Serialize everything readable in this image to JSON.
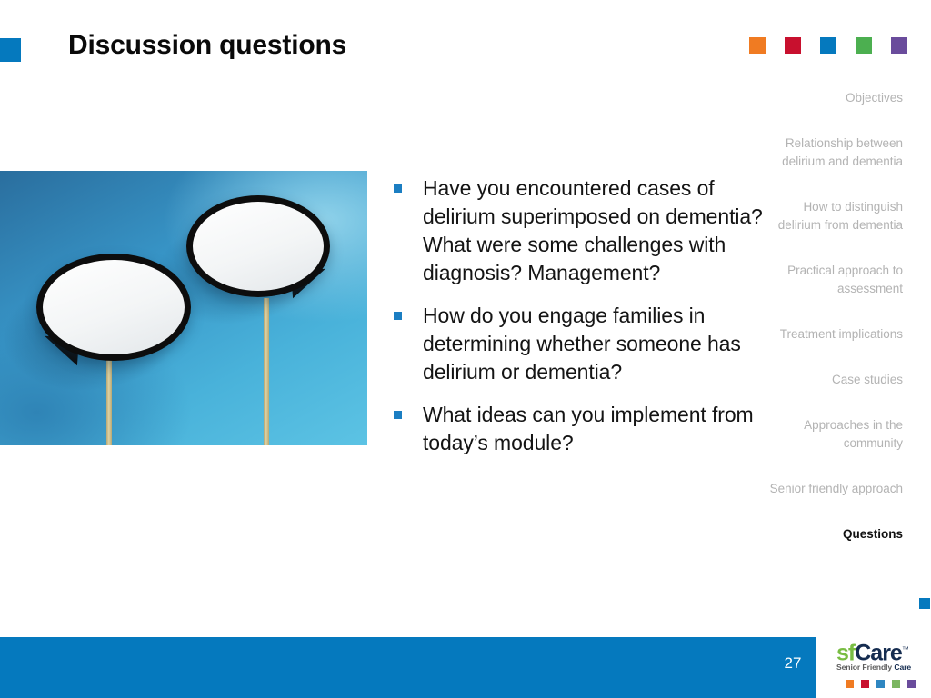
{
  "slide": {
    "title": "Discussion questions",
    "page_number": "27"
  },
  "theme": {
    "accent_blue": "#0579BE",
    "bullet_blue": "#1B7EC2",
    "chip_colors": [
      "#F07B22",
      "#C8102E",
      "#0579BE",
      "#4CAF50",
      "#6A4C9C"
    ],
    "nav_inactive": "#b3b3b3",
    "nav_active": "#111111"
  },
  "bullets": [
    "Have you encountered cases of delirium superimposed on dementia? What were some challenges with diagnosis? Management?",
    "How do you engage families in determining whether someone has delirium or dementia?",
    "What ideas can you implement from today’s module?"
  ],
  "sidenav": {
    "items": [
      {
        "label": "Objectives",
        "active": false
      },
      {
        "label": "Relationship between delirium and dementia",
        "active": false
      },
      {
        "label": "How to distinguish delirium from dementia",
        "active": false
      },
      {
        "label": "Practical approach to assessment",
        "active": false
      },
      {
        "label": "Treatment implications",
        "active": false
      },
      {
        "label": "Case studies",
        "active": false
      },
      {
        "label": "Approaches in the community",
        "active": false
      },
      {
        "label": "Senior friendly approach",
        "active": false
      },
      {
        "label": "Questions",
        "active": true
      }
    ]
  },
  "photo": {
    "alt": "Two white speech bubble signs on wooden sticks against a blue background"
  },
  "logo": {
    "sf": "sf",
    "care": "Care",
    "tm": "™",
    "tagline_lead": "Senior Friendly ",
    "tagline_accent": "Care",
    "dot_colors": [
      "#F07B22",
      "#C8102E",
      "#2E86C1",
      "#7BB661",
      "#6A4C9C"
    ]
  }
}
